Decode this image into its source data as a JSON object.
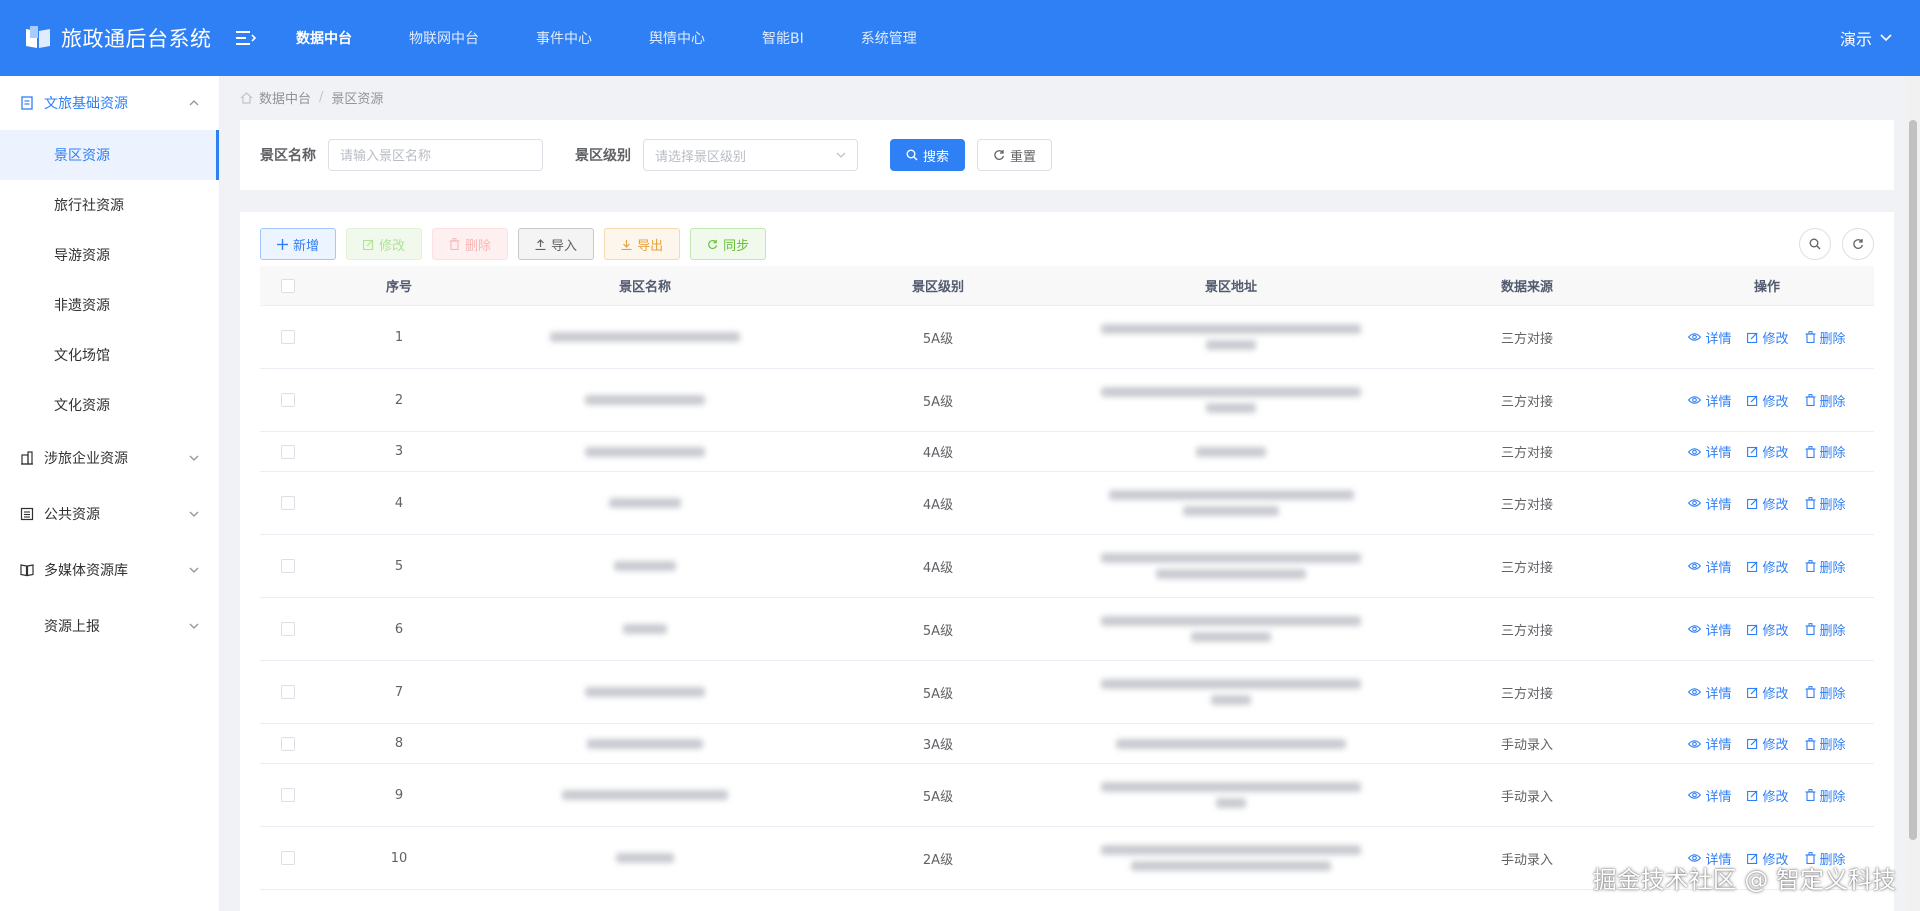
{
  "header": {
    "title": "旅政通后台系统",
    "nav": [
      {
        "label": "数据中台",
        "active": true
      },
      {
        "label": "物联网中台",
        "active": false
      },
      {
        "label": "事件中心",
        "active": false
      },
      {
        "label": "舆情中心",
        "active": false
      },
      {
        "label": "智能BI",
        "active": false
      },
      {
        "label": "系统管理",
        "active": false
      }
    ],
    "user": "演示"
  },
  "sidebar": {
    "group_open": "文旅基础资源",
    "sub_items": [
      {
        "label": "景区资源",
        "active": true
      },
      {
        "label": "旅行社资源",
        "active": false
      },
      {
        "label": "导游资源",
        "active": false
      },
      {
        "label": "非遗资源",
        "active": false
      },
      {
        "label": "文化场馆",
        "active": false
      },
      {
        "label": "文化资源",
        "active": false
      }
    ],
    "groups": [
      {
        "label": "涉旅企业资源",
        "icon": "building-icon"
      },
      {
        "label": "公共资源",
        "icon": "list-icon"
      },
      {
        "label": "多媒体资源库",
        "icon": "book-icon"
      },
      {
        "label": "资源上报",
        "icon": ""
      }
    ]
  },
  "breadcrumb": [
    "数据中台",
    "景区资源"
  ],
  "search": {
    "name_label": "景区名称",
    "name_placeholder": "请输入景区名称",
    "level_label": "景区级别",
    "level_placeholder": "请选择景区级别",
    "search_btn": "搜索",
    "reset_btn": "重置"
  },
  "toolbar": {
    "add": "新增",
    "edit": "修改",
    "delete": "删除",
    "import": "导入",
    "export": "导出",
    "sync": "同步"
  },
  "table": {
    "headers": [
      "序号",
      "景区名称",
      "景区级别",
      "景区地址",
      "数据来源",
      "操作"
    ],
    "rows": [
      {
        "no": "1",
        "level": "5A级",
        "source": "三方对接"
      },
      {
        "no": "2",
        "level": "5A级",
        "source": "三方对接"
      },
      {
        "no": "3",
        "level": "4A级",
        "source": "三方对接"
      },
      {
        "no": "4",
        "level": "4A级",
        "source": "三方对接"
      },
      {
        "no": "5",
        "level": "4A级",
        "source": "三方对接"
      },
      {
        "no": "6",
        "level": "5A级",
        "source": "三方对接"
      },
      {
        "no": "7",
        "level": "5A级",
        "source": "三方对接"
      },
      {
        "no": "8",
        "level": "3A级",
        "source": "手动录入"
      },
      {
        "no": "9",
        "level": "5A级",
        "source": "手动录入"
      },
      {
        "no": "10",
        "level": "2A级",
        "source": "手动录入"
      }
    ],
    "actions": {
      "detail": "详情",
      "edit": "修改",
      "delete": "删除"
    }
  },
  "watermark": "掘金技术社区 @ 智定义科技",
  "colors": {
    "primary": "#2f7ff5",
    "success": "#67c23a",
    "warning": "#e6a23c",
    "danger": "#f56c6c"
  }
}
